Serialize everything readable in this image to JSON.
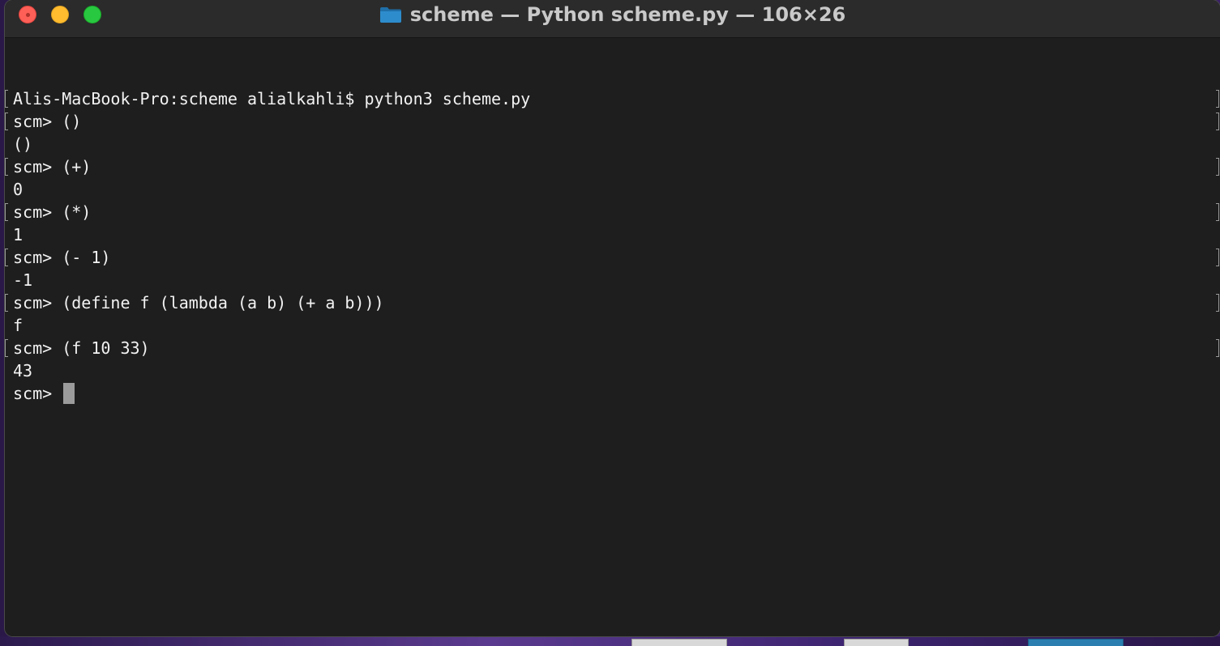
{
  "window": {
    "title": "scheme — Python scheme.py — 106×26",
    "folder_icon": "folder-icon"
  },
  "terminal": {
    "lines": [
      {
        "text": "Alis-MacBook-Pro:scheme alialkahli$ python3 scheme.py",
        "marked": true
      },
      {
        "text": "scm> ()",
        "marked": true
      },
      {
        "text": "()",
        "marked": false
      },
      {
        "text": "scm> (+)",
        "marked": true
      },
      {
        "text": "0",
        "marked": false
      },
      {
        "text": "scm> (*)",
        "marked": true
      },
      {
        "text": "1",
        "marked": false
      },
      {
        "text": "scm> (- 1)",
        "marked": true
      },
      {
        "text": "-1",
        "marked": false
      },
      {
        "text": "scm> (define f (lambda (a b) (+ a b)))",
        "marked": true
      },
      {
        "text": "f",
        "marked": false
      },
      {
        "text": "scm> (f 10 33)",
        "marked": true
      },
      {
        "text": "43",
        "marked": false
      }
    ],
    "prompt": "scm> "
  },
  "colors": {
    "background": "#1e1e1e",
    "text": "#f2f2f2",
    "titlebar": "#2b2b2b",
    "close": "#fe5f57",
    "minimize": "#febc2e",
    "zoom": "#28c840",
    "cursor": "#9b9b9b"
  }
}
